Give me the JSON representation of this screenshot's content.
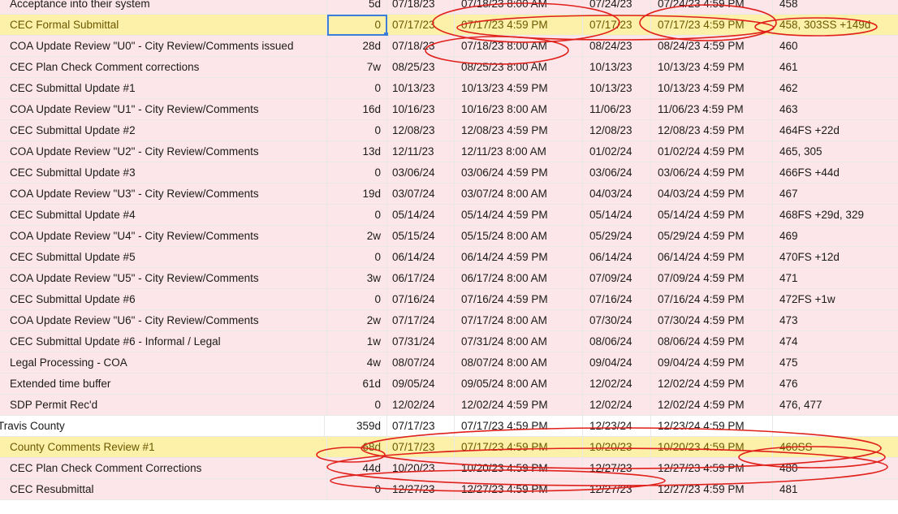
{
  "rows": [
    {
      "task": "Acceptance into their system",
      "dur": "5d",
      "start": "07/18/23",
      "startTime": "07/18/23 8:00 AM",
      "end": "07/24/23",
      "endTime": "07/24/23 4:59 PM",
      "pred": "458",
      "style": "normal"
    },
    {
      "task": "CEC Formal Submittal",
      "dur": "0",
      "start": "07/17/23",
      "startTime": "07/17/23 4:59 PM",
      "end": "07/17/23",
      "endTime": "07/17/23 4:59 PM",
      "pred": "458, 303SS +149d",
      "style": "hl"
    },
    {
      "task": "COA Update Review \"U0\" - City Review/Comments issued",
      "dur": "28d",
      "start": "07/18/23",
      "startTime": "07/18/23 8:00 AM",
      "end": "08/24/23",
      "endTime": "08/24/23 4:59 PM",
      "pred": "460",
      "style": "normal"
    },
    {
      "task": "CEC Plan Check Comment corrections",
      "dur": "7w",
      "start": "08/25/23",
      "startTime": "08/25/23 8:00 AM",
      "end": "10/13/23",
      "endTime": "10/13/23 4:59 PM",
      "pred": "461",
      "style": "normal"
    },
    {
      "task": "CEC Submittal Update #1",
      "dur": "0",
      "start": "10/13/23",
      "startTime": "10/13/23 4:59 PM",
      "end": "10/13/23",
      "endTime": "10/13/23 4:59 PM",
      "pred": "462",
      "style": "normal"
    },
    {
      "task": "COA Update Review \"U1\" - City Review/Comments",
      "dur": "16d",
      "start": "10/16/23",
      "startTime": "10/16/23 8:00 AM",
      "end": "11/06/23",
      "endTime": "11/06/23 4:59 PM",
      "pred": "463",
      "style": "normal"
    },
    {
      "task": "CEC Submittal Update #2",
      "dur": "0",
      "start": "12/08/23",
      "startTime": "12/08/23 4:59 PM",
      "end": "12/08/23",
      "endTime": "12/08/23 4:59 PM",
      "pred": "464FS +22d",
      "style": "normal"
    },
    {
      "task": "COA Update Review \"U2\" - City Review/Comments",
      "dur": "13d",
      "start": "12/11/23",
      "startTime": "12/11/23 8:00 AM",
      "end": "01/02/24",
      "endTime": "01/02/24 4:59 PM",
      "pred": "465, 305",
      "style": "normal"
    },
    {
      "task": "CEC Submittal Update #3",
      "dur": "0",
      "start": "03/06/24",
      "startTime": "03/06/24 4:59 PM",
      "end": "03/06/24",
      "endTime": "03/06/24 4:59 PM",
      "pred": "466FS +44d",
      "style": "normal"
    },
    {
      "task": "COA Update Review \"U3\" - City Review/Comments",
      "dur": "19d",
      "start": "03/07/24",
      "startTime": "03/07/24 8:00 AM",
      "end": "04/03/24",
      "endTime": "04/03/24 4:59 PM",
      "pred": "467",
      "style": "normal"
    },
    {
      "task": "CEC Submittal Update #4",
      "dur": "0",
      "start": "05/14/24",
      "startTime": "05/14/24 4:59 PM",
      "end": "05/14/24",
      "endTime": "05/14/24 4:59 PM",
      "pred": "468FS +29d, 329",
      "style": "normal"
    },
    {
      "task": "COA Update Review \"U4\" - City Review/Comments",
      "dur": "2w",
      "start": "05/15/24",
      "startTime": "05/15/24 8:00 AM",
      "end": "05/29/24",
      "endTime": "05/29/24 4:59 PM",
      "pred": "469",
      "style": "normal"
    },
    {
      "task": "CEC Submittal Update #5",
      "dur": "0",
      "start": "06/14/24",
      "startTime": "06/14/24 4:59 PM",
      "end": "06/14/24",
      "endTime": "06/14/24 4:59 PM",
      "pred": "470FS +12d",
      "style": "normal"
    },
    {
      "task": "COA Update Review \"U5\" - City Review/Comments",
      "dur": "3w",
      "start": "06/17/24",
      "startTime": "06/17/24 8:00 AM",
      "end": "07/09/24",
      "endTime": "07/09/24 4:59 PM",
      "pred": "471",
      "style": "normal"
    },
    {
      "task": "CEC Submittal Update #6",
      "dur": "0",
      "start": "07/16/24",
      "startTime": "07/16/24 4:59 PM",
      "end": "07/16/24",
      "endTime": "07/16/24 4:59 PM",
      "pred": "472FS +1w",
      "style": "normal"
    },
    {
      "task": "COA Update Review \"U6\" - City Review/Comments",
      "dur": "2w",
      "start": "07/17/24",
      "startTime": "07/17/24 8:00 AM",
      "end": "07/30/24",
      "endTime": "07/30/24 4:59 PM",
      "pred": "473",
      "style": "normal"
    },
    {
      "task": "CEC Submittal Update #6 - Informal / Legal",
      "dur": "1w",
      "start": "07/31/24",
      "startTime": "07/31/24 8:00 AM",
      "end": "08/06/24",
      "endTime": "08/06/24 4:59 PM",
      "pred": "474",
      "style": "normal"
    },
    {
      "task": "Legal Processing - COA",
      "dur": "4w",
      "start": "08/07/24",
      "startTime": "08/07/24 8:00 AM",
      "end": "09/04/24",
      "endTime": "09/04/24 4:59 PM",
      "pred": "475",
      "style": "normal"
    },
    {
      "task": "Extended time buffer",
      "dur": "61d",
      "start": "09/05/24",
      "startTime": "09/05/24 8:00 AM",
      "end": "12/02/24",
      "endTime": "12/02/24 4:59 PM",
      "pred": "476",
      "style": "normal"
    },
    {
      "task": "SDP Permit Rec'd",
      "dur": "0",
      "start": "12/02/24",
      "startTime": "12/02/24 4:59 PM",
      "end": "12/02/24",
      "endTime": "12/02/24 4:59 PM",
      "pred": "476, 477",
      "style": "normal"
    },
    {
      "task": "Travis County",
      "dur": "359d",
      "start": "07/17/23",
      "startTime": "07/17/23 4:59 PM",
      "end": "12/23/24",
      "endTime": "12/23/24 4:59 PM",
      "pred": "",
      "style": "sec"
    },
    {
      "task": "County Comments Review #1",
      "dur": "68d",
      "start": "07/17/23",
      "startTime": "07/17/23 4:59 PM",
      "end": "10/20/23",
      "endTime": "10/20/23 4:59 PM",
      "pred": "460SS",
      "style": "hl"
    },
    {
      "task": "CEC Plan Check Comment Corrections",
      "dur": "44d",
      "start": "10/20/23",
      "startTime": "10/20/23 4:59 PM",
      "end": "12/27/23",
      "endTime": "12/27/23 4:59 PM",
      "pred": "480",
      "style": "normal"
    },
    {
      "task": "CEC Resubmittal",
      "dur": "0",
      "start": "12/27/23",
      "startTime": "12/27/23 4:59 PM",
      "end": "12/27/23",
      "endTime": "12/27/23 4:59 PM",
      "pred": "481",
      "style": "normal"
    }
  ],
  "colors": {
    "annotation": "#e0201b",
    "highlight": "#fdf0a8",
    "row": "#fde6e9",
    "selection": "#3b7dd8"
  }
}
